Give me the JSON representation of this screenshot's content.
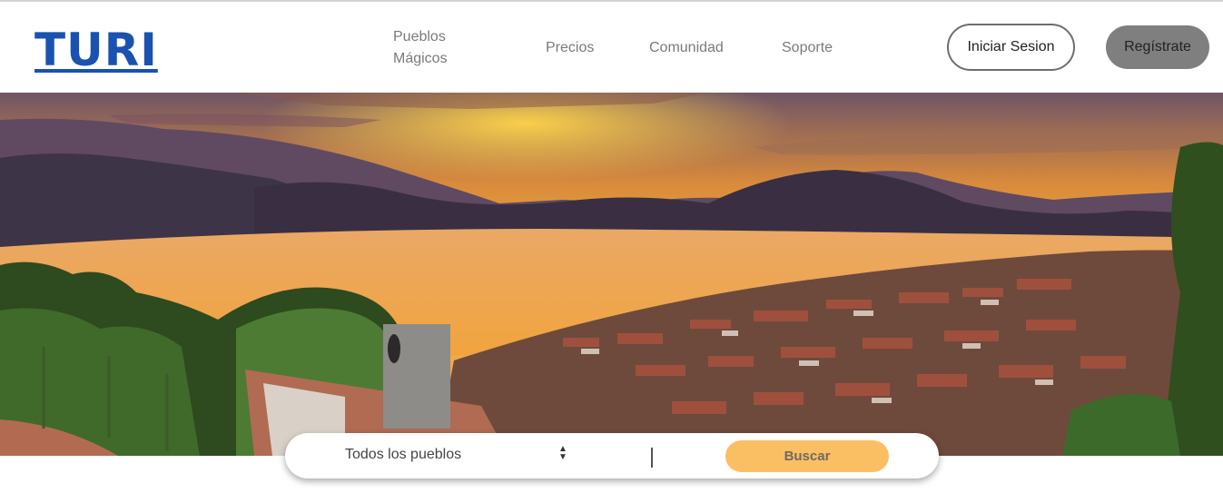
{
  "brand": {
    "logo_text": "TURI",
    "color": "#1a52b0"
  },
  "nav": {
    "items": [
      {
        "label": "Pueblos Mágicos"
      },
      {
        "label": "Precios"
      },
      {
        "label": "Comunidad"
      },
      {
        "label": "Soporte"
      }
    ]
  },
  "auth": {
    "login_label": "Iniciar Sesion",
    "register_label": "Regístrate"
  },
  "hero": {
    "image_subject": "sunset over lake and hillside town",
    "colors": {
      "sky_top": "#7a5a6a",
      "sky_glow": "#f4b12e",
      "lake": "#f0a94a",
      "roofs": "#8a4a3a"
    }
  },
  "search": {
    "select_value": "Todos los pueblos",
    "button_label": "Buscar",
    "button_color": "#fbbf63"
  }
}
